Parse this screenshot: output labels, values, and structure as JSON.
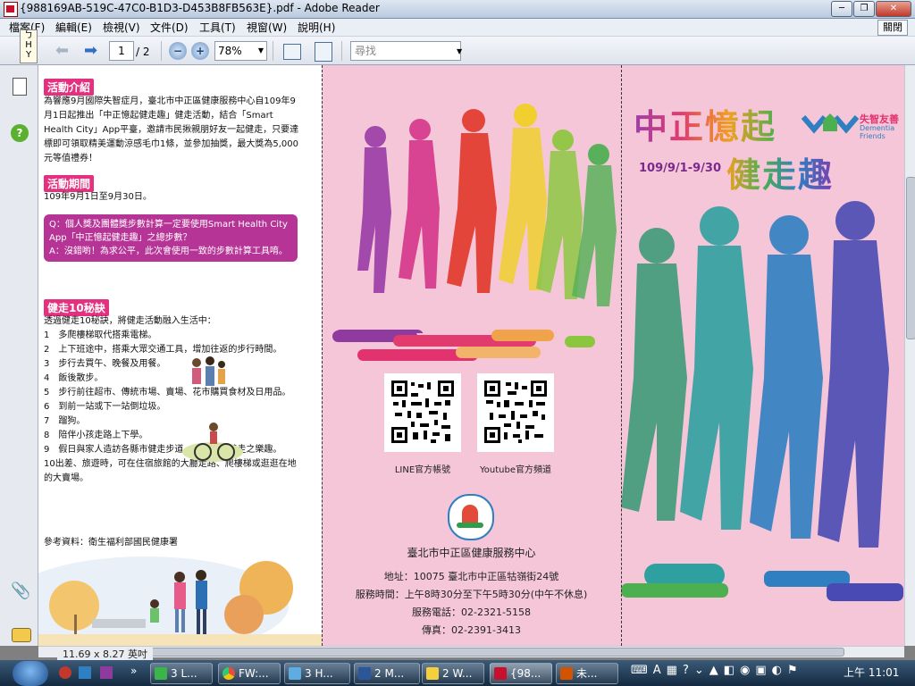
{
  "window": {
    "title": "{988169AB-519C-47C0-B1D3-D453B8FB563E}.pdf - Adobe Reader",
    "min_label": "─",
    "max_label": "❐",
    "close_label": "✕"
  },
  "menu": {
    "items": [
      "檔案(F)",
      "編輯(E)",
      "檢視(V)",
      "文件(D)",
      "工具(T)",
      "視窗(W)",
      "說明(H)"
    ],
    "close_label": "關閉"
  },
  "toolbar": {
    "page_current": "1",
    "page_total": "/ 2",
    "zoom": "78%",
    "search_placeholder": "尋找"
  },
  "status": {
    "page_size": "11.69 x 8.27 英吋"
  },
  "left_page": {
    "s1_title": "活動介紹",
    "s1_body": "為響應9月國際失智症月，臺北市中正區健康服務中心自109年9月1日起推出「中正憶起健走趣」健走活動，結合「Smart Health City」App平臺，邀請市民揪親朋好友一起健走，只要達標即可領取精美運動涼感毛巾1條，並參加抽獎，最大獎為5,000元等值禮券！",
    "s2_title": "活動期間",
    "s2_body": "109年9月1日至9月30日。",
    "q_text": "Q：個人獎及團體獎步數計算一定要使用Smart Health City App「中正憶起健走趣」之總步數？",
    "a_text": "A：沒錯喲！為求公平，此次會使用一致的步數計算工具唷。",
    "s3_title": "健走10秘訣",
    "s3_intro": "透過健走10秘訣，將健走活動融入生活中：",
    "tips": [
      "1　多爬樓梯取代搭乘電梯。",
      "2　上下班途中，搭乘大眾交通工具，增加往返的步行時間。",
      "3　步行去買午、晚餐及用餐。",
      "4　飯後散步。",
      "5　步行前往超市、傳統市場、賣場、花市購買食材及日用品。",
      "6　到前一站或下一站倒垃圾。",
      "7　蹓狗。",
      "8　陪伴小孩走路上下學。",
      "9　假日與家人造訪各縣市健走步道，一起享受健走之樂趣。",
      "10出差、旅遊時，可在住宿旅館的大廳走路、爬樓梯或逛逛在地的大賣場。"
    ],
    "reference": "參考資料：衛生福利部國民健康署"
  },
  "mid_page": {
    "qr1_label": "LINE官方帳號",
    "qr2_label": "Youtube官方頻道",
    "org_name": "臺北市中正區健康服務中心",
    "address": "地址：10075  臺北市中正區牯嶺街24號",
    "hours": "服務時間：上午8時30分至下午5時30分(中午不休息)",
    "phone": "服務電話：02-2321-5158",
    "fax": "傳真：02-2391-3413"
  },
  "right_page": {
    "title1": "中正憶起",
    "title2": "健走趣",
    "dates": "109/9/1-9/30",
    "friendly_cn": "失智友善",
    "friendly_en1": "Dementia",
    "friendly_en2": "Friends"
  },
  "taskbar": {
    "items": [
      "3 L...",
      "FW:...",
      "3 H...",
      "2 M...",
      "2 W...",
      "{98...",
      "未..."
    ],
    "clock": "上午 11:01"
  }
}
